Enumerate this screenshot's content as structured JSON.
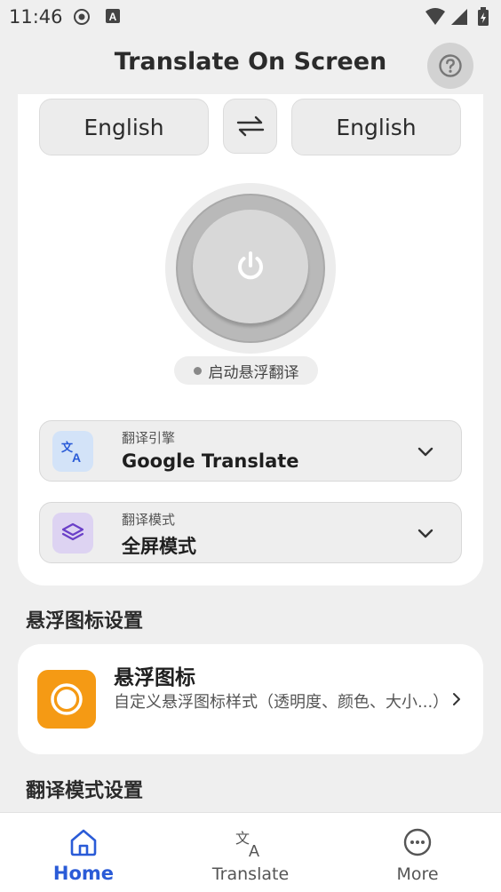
{
  "status_bar": {
    "time": "11:46"
  },
  "header": {
    "title": "Translate On Screen"
  },
  "languages": {
    "source": "English",
    "target": "English"
  },
  "power": {
    "status_label": "启动悬浮翻译"
  },
  "engine": {
    "label": "翻译引擎",
    "value": "Google Translate"
  },
  "mode": {
    "label": "翻译模式",
    "value": "全屏模式"
  },
  "float_section": {
    "title": "悬浮图标设置",
    "item_title": "悬浮图标",
    "item_desc": "自定义悬浮图标样式（透明度、颜色、大小...）"
  },
  "mode_section": {
    "title": "翻译模式设置"
  },
  "bottom_nav": {
    "items": [
      {
        "label": "Home",
        "active": true
      },
      {
        "label": "Translate",
        "active": false
      },
      {
        "label": "More",
        "active": false
      }
    ]
  },
  "colors": {
    "accent": "#2a5bd7",
    "float_icon": "#f59a14",
    "engine_icon_bg": "#d3e3f8",
    "mode_icon_bg": "#ddd3f2"
  }
}
